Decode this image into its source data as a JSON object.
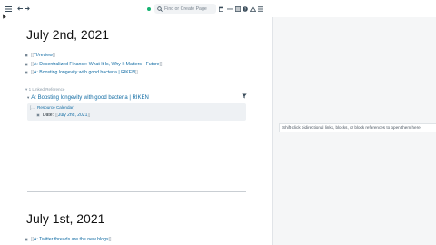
{
  "topbar": {
    "search_placeholder": "Find or Create Page"
  },
  "page1": {
    "title": "July 2nd, 2021",
    "blocks": [
      {
        "text": "TI/review"
      },
      {
        "text": "A: Decentralized Finance: What It Is, Why It Matters - Future"
      },
      {
        "text": "A: Boosting longevity with good bacteria | RIKEN"
      }
    ]
  },
  "linked_refs": {
    "label": "1 Linked Reference",
    "group_title": "A: Boosting longevity with good bacteria | RIKEN",
    "breadcrumb": "Resource Calendar",
    "attr_key": "Date:",
    "attr_value": "July 2nd, 2021"
  },
  "page2": {
    "title": "July 1st, 2021",
    "blocks": [
      {
        "text": "A: Twitter threads are the new blogs"
      }
    ]
  },
  "sidebar": {
    "hint": "Shift-click bidirectional links, blocks, or block references to open them here"
  }
}
